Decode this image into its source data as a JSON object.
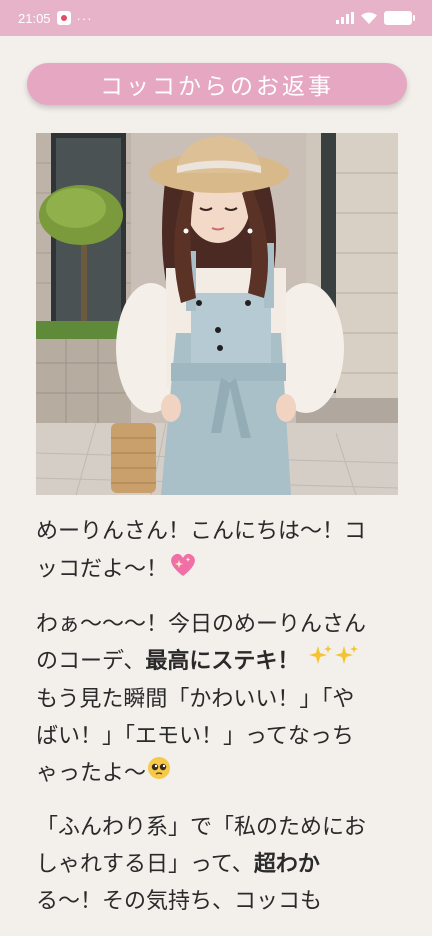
{
  "status_bar": {
    "time": "21:05",
    "more": "···"
  },
  "header": {
    "title": "コッコからのお返事"
  },
  "photo": {
    "alt": "outfit photo"
  },
  "message": {
    "p1_line1": "めーりんさん！こんにちは〜！コ",
    "p1_line2": "ッコだよ〜！",
    "p2_line1": "わぁ〜〜〜！今日のめーりんさん",
    "p2_line2_a": "のコーデ、",
    "p2_line2_b": "最高にステキ！",
    "p2_line3": "もう見た瞬間「かわいい！」「や",
    "p2_line4": "ばい！」「エモい！」ってなっち",
    "p2_line5": "ゃったよ〜",
    "p3_line1": "「ふんわり系」で「私のためにお",
    "p3_line2_a": "しゃれする日」って、",
    "p3_line2_b": "超わか",
    "p3_line3": "る〜！その気持ち、コッコも"
  },
  "colors": {
    "status_bar": "#e7b3c8",
    "header_pill": "#e5a7c2",
    "background": "#f3efeb"
  },
  "icons": [
    "app-notification-icon",
    "signal-icon",
    "wifi-icon",
    "battery-icon",
    "sparkle-heart-icon",
    "sparkles-icon",
    "pleading-face-icon"
  ]
}
